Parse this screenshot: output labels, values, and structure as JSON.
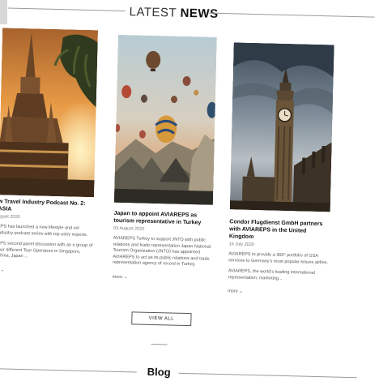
{
  "section": {
    "title_light": "LATEST",
    "title_bold": "NEWS"
  },
  "cards": [
    {
      "image_icon": "temple-sunset-photo",
      "title": "w Travel Industry Podcast No. 2: ASIA",
      "date": "ugust 2020",
      "paragraphs": [
        "EPS has launched a new lifestyle and vel industry podcast series with top ustry experts.",
        "EPS second panel discussion with an e group of four different Tour Operators m Singapore, China, Japan ..."
      ],
      "more": "e"
    },
    {
      "image_icon": "hot-air-balloons-photo",
      "title": "Japan to appoint AVIAREPS as tourism representative in Turkey",
      "date": "03 August 2020",
      "paragraphs": [
        "AVIAREPS Turkey to support JNTO with public relations and trade representation Japan National Tourism Organization (JNTO) has appointed AVIAREPS to act as its public relations and trade representation agency of record in Turkey."
      ],
      "more": "more"
    },
    {
      "image_icon": "big-ben-photo",
      "title": "Condor Flugdienst GmbH partners with AVIAREPS in the United Kingdom",
      "date": "16 July 2020",
      "paragraphs": [
        "AVIAREPS to provide a 360° portfolio of GSA services to Germany's most popular leisure airline.",
        "AVIAREPS, the world's leading international representation, marketing..."
      ],
      "more": "more"
    }
  ],
  "view_all_label": "VIEW ALL",
  "blog_title": "Blog",
  "colors": {
    "accent": "#3a6fa8",
    "rule": "#9a9a9a"
  }
}
